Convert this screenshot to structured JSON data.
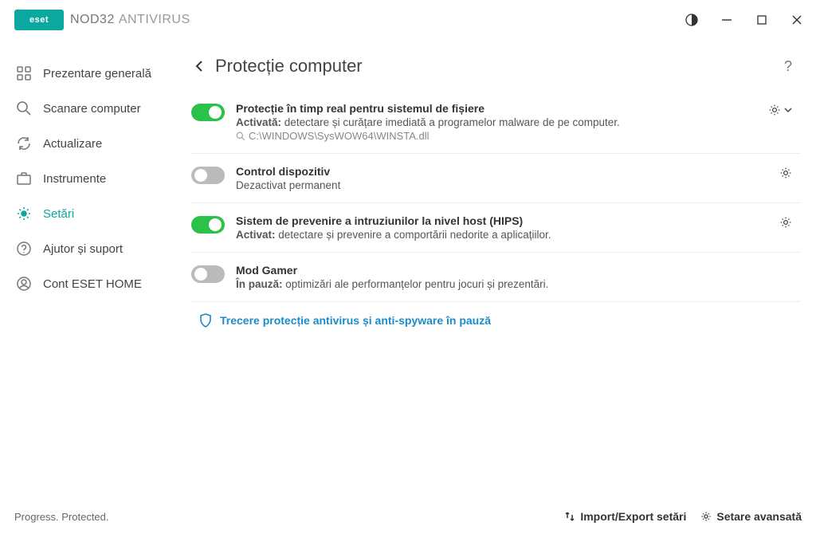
{
  "app": {
    "brand": "eset",
    "product_primary": "NOD32",
    "product_secondary": "ANTIVIRUS"
  },
  "sidebar": {
    "items": [
      {
        "label": "Prezentare generală"
      },
      {
        "label": "Scanare computer"
      },
      {
        "label": "Actualizare"
      },
      {
        "label": "Instrumente"
      },
      {
        "label": "Setări"
      },
      {
        "label": "Ajutor și suport"
      },
      {
        "label": "Cont ESET HOME"
      }
    ]
  },
  "page": {
    "title": "Protecție computer",
    "help": "?",
    "settings": [
      {
        "title": "Protecție în timp real pentru sistemul de fișiere",
        "status": "Activată:",
        "desc": "detectare și curățare imediată a programelor malware de pe computer.",
        "scan_path": "C:\\WINDOWS\\SysWOW64\\WINSTA.dll",
        "toggle_on": true,
        "gear_chevron": true
      },
      {
        "title": "Control dispozitiv",
        "status": "",
        "desc": "Dezactivat permanent",
        "toggle_on": false,
        "gear": true
      },
      {
        "title": "Sistem de prevenire a intruziunilor la nivel host (HIPS)",
        "status": "Activat:",
        "desc": "detectare și prevenire a comportării nedorite a aplicațiilor.",
        "toggle_on": true,
        "gear": true
      },
      {
        "title": "Mod Gamer",
        "status": "În pauză:",
        "desc": "optimizări ale performanțelor pentru jocuri și prezentări.",
        "toggle_on": false
      }
    ],
    "pause_link": "Trecere protecție antivirus și anti-spyware în pauză"
  },
  "footer": {
    "tagline": "Progress. Protected.",
    "import_export": "Import/Export setări",
    "advanced": "Setare avansată"
  }
}
